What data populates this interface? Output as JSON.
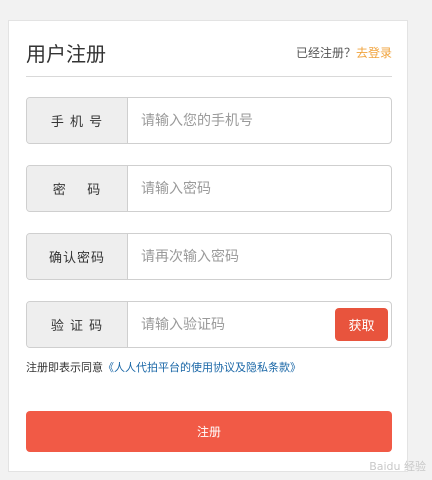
{
  "header": {
    "title": "用户注册",
    "already_registered": "已经注册？",
    "login_link": "去登录"
  },
  "fields": [
    {
      "label": "手 机 号",
      "placeholder": "请输入您的手机号"
    },
    {
      "label": "密    码",
      "placeholder": "请输入密码"
    },
    {
      "label": "确认密码",
      "placeholder": "请再次输入密码"
    },
    {
      "label": "验 证 码",
      "placeholder": "请输入验证码",
      "button": "获取"
    }
  ],
  "agreement": {
    "prefix": "注册即表示同意",
    "link": "《人人代拍平台的使用协议及隐私条款》"
  },
  "submit_label": "注册",
  "watermark": "Baidu 经验",
  "colors": {
    "accent": "#f15a46",
    "link_orange": "#f0a33d",
    "link_blue": "#1a67a7"
  }
}
